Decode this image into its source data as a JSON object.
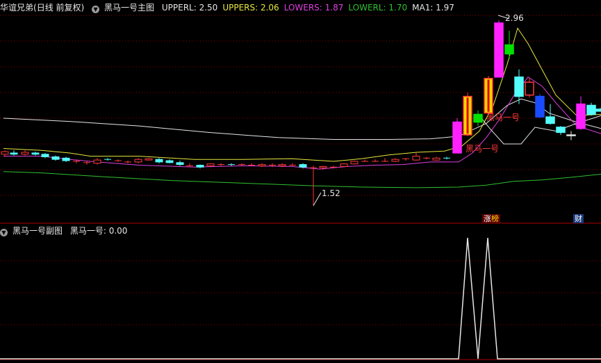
{
  "main_header": {
    "stock_name": "华谊兄弟",
    "period": "(日线 前复权)",
    "indicator_name": "黑马一号主图",
    "items": [
      {
        "label": "UPPERL: 2.50",
        "color": "#e6e6e6"
      },
      {
        "label": "UPPERS: 2.06",
        "color": "#e8e840"
      },
      {
        "label": "LOWERS: 1.87",
        "color": "#e040e0"
      },
      {
        "label": "LOWERL: 1.70",
        "color": "#30c030"
      },
      {
        "label": "MA1: 1.97",
        "color": "#e6e6e6"
      }
    ]
  },
  "sub_header": {
    "indicator_name": "黑马一号副图",
    "value_label": "黑马一号: 0.00"
  },
  "annotations": {
    "high_label": "2.96",
    "low_label": "1.52",
    "signal_label_1": "黑马一号",
    "signal_label_2": "黑马一号"
  },
  "badges": {
    "limit_up": "涨",
    "ranking": "榜",
    "finance": "财"
  },
  "colors": {
    "up": "#ff3a3a",
    "down": "#54fcfc",
    "magenta": "#ff22ff",
    "gold": "#ffd700",
    "blue": "#1a4cff",
    "green": "#00e000",
    "grid": "#8a0000",
    "divider": "#b00000"
  },
  "chart_data": {
    "type": "candlestick",
    "series": [
      {
        "name": "UPPERL",
        "color": "#e6e6e6"
      },
      {
        "name": "UPPERS",
        "color": "#e8e840"
      },
      {
        "name": "LOWERS",
        "color": "#e040e0"
      },
      {
        "name": "LOWERL",
        "color": "#30c030"
      },
      {
        "name": "MA1",
        "color": "#e6e6e6"
      }
    ],
    "latest": {
      "UPPERL": 2.5,
      "UPPERS": 2.06,
      "LOWERS": 1.87,
      "LOWERL": 1.7,
      "MA1": 1.97
    },
    "visible_high": 2.96,
    "visible_low": 1.52,
    "sub_indicator": {
      "name": "黑马一号",
      "value": 0.0,
      "peaks": 2
    }
  }
}
